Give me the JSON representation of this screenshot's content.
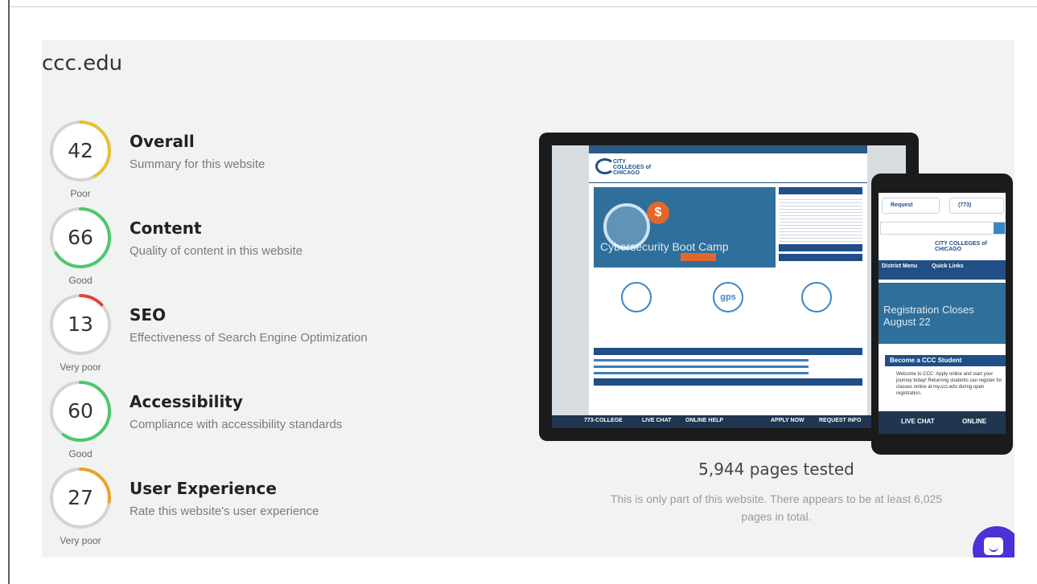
{
  "site": {
    "title": "ccc.edu"
  },
  "metrics": [
    {
      "name": "Overall",
      "description": "Summary for this website",
      "score": 42,
      "rating": "Poor",
      "color": "#e8c131"
    },
    {
      "name": "Content",
      "description": "Quality of content in this website",
      "score": 66,
      "rating": "Good",
      "color": "#4cc96a"
    },
    {
      "name": "SEO",
      "description": "Effectiveness of Search Engine Optimization",
      "score": 13,
      "rating": "Very poor",
      "color": "#e0453a"
    },
    {
      "name": "Accessibility",
      "description": "Compliance with accessibility standards",
      "score": 60,
      "rating": "Good",
      "color": "#4cc96a"
    },
    {
      "name": "User Experience",
      "description": "Rate this website's user experience",
      "score": 27,
      "rating": "Very poor",
      "color": "#f0a028"
    }
  ],
  "preview": {
    "laptop": {
      "logo": "CITY COLLEGES of CHICAGO",
      "hero_text": "Cybersecurity Boot Camp",
      "bottom_bar": [
        "773-COLLEGE",
        "LIVE CHAT",
        "ONLINE HELP",
        "APPLY NOW",
        "REQUEST INFO"
      ]
    },
    "phone": {
      "buttons": [
        "Request",
        "(773)"
      ],
      "logo": "CITY COLLEGES of CHICAGO",
      "tabs": [
        "District Menu",
        "Quick Links"
      ],
      "hero_text": "Registration Closes August 22",
      "bar_label": "Become a CCC Student",
      "welcome": "Welcome to CCC: Apply online and start your journey today! Returning students can register for classes online at my.ccc.edu during open registration.",
      "bottom_bar": [
        "LIVE CHAT",
        "ONLINE"
      ]
    }
  },
  "summary": {
    "pages_tested": "5,944 pages tested",
    "note": "This is only part of this website. There appears to be at least 6,025 pages in total."
  },
  "colors": {
    "panel_bg": "#f1f3f3",
    "gauge_track": "#d4d4d4",
    "chat_accent": "#4a32d6"
  }
}
